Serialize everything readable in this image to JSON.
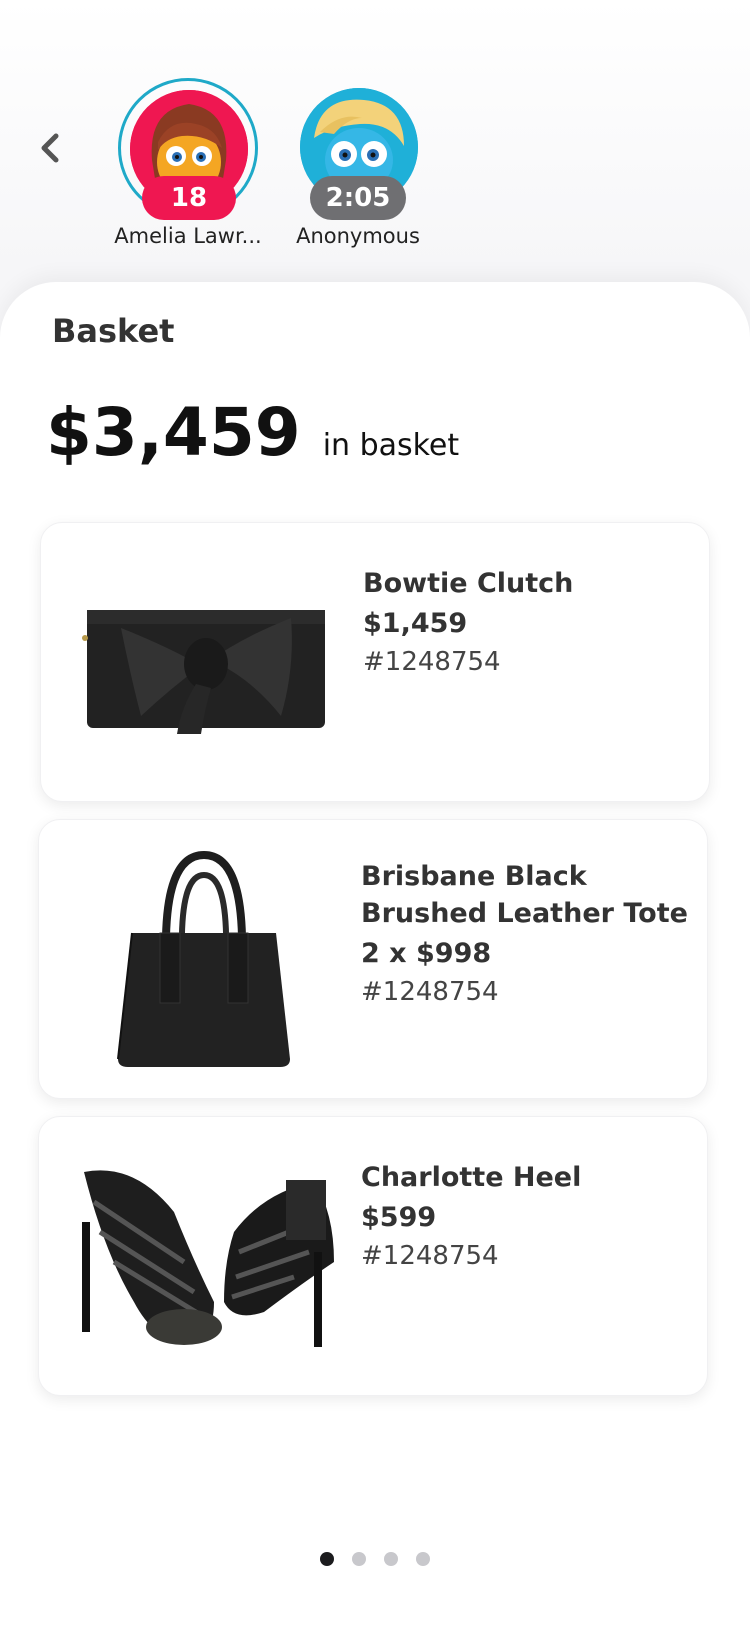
{
  "nav": {
    "back_icon": "chevron-left-icon"
  },
  "viewers": [
    {
      "name": "Amelia Lawr...",
      "badge": "18",
      "badge_color": "#ef1751",
      "avatar_color": "#ef1751",
      "ring_color": "#1fa9c8"
    },
    {
      "name": "Anonymous",
      "badge": "2:05",
      "badge_color": "#6f6f72",
      "avatar_color": "#1fb0d8"
    }
  ],
  "basket": {
    "title": "Basket",
    "total": "$3,459",
    "total_suffix": "in basket",
    "items": [
      {
        "name": "Bowtie Clutch",
        "price": "$1,459",
        "sku": "#1248754",
        "image": "bowtie-clutch"
      },
      {
        "name": "Brisbane Black Brushed Leather Tote",
        "price": "2 x $998",
        "sku": "#1248754",
        "image": "leather-tote"
      },
      {
        "name": "Charlotte Heel",
        "price": "$599",
        "sku": "#1248754",
        "image": "strappy-heels"
      }
    ]
  },
  "pagination": {
    "count": 4,
    "active_index": 0
  }
}
